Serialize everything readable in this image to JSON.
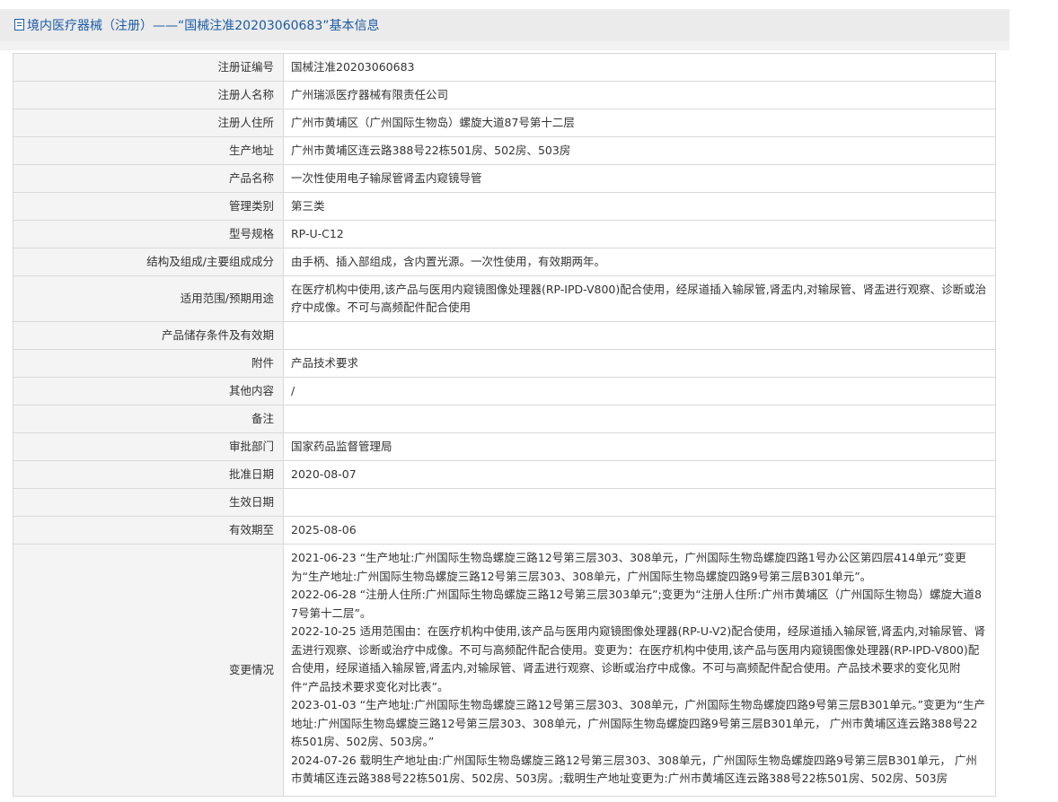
{
  "header": {
    "title": "境内医疗器械（注册）——“国械注准20203060683”基本信息"
  },
  "rows": [
    {
      "label": "注册证编号",
      "value": "国械注准20203060683"
    },
    {
      "label": "注册人名称",
      "value": "广州瑞派医疗器械有限责任公司"
    },
    {
      "label": "注册人住所",
      "value": "广州市黄埔区（广州国际生物岛）螺旋大道87号第十二层"
    },
    {
      "label": "生产地址",
      "value": "广州市黄埔区连云路388号22栋501房、502房、503房"
    },
    {
      "label": "产品名称",
      "value": "一次性使用电子输尿管肾盂内窥镜导管"
    },
    {
      "label": "管理类别",
      "value": "第三类"
    },
    {
      "label": "型号规格",
      "value": "RP-U-C12"
    },
    {
      "label": "结构及组成/主要组成成分",
      "value": "由手柄、插入部组成，含内置光源。一次性使用，有效期两年。"
    },
    {
      "label": "适用范围/预期用途",
      "value": "在医疗机构中使用,该产品与医用内窥镜图像处理器(RP-IPD-V800)配合使用，经尿道插入输尿管,肾盂内,对输尿管、肾盂进行观察、诊断或治疗中成像。不可与高频配件配合使用"
    },
    {
      "label": "产品储存条件及有效期",
      "value": ""
    },
    {
      "label": "附件",
      "value": "产品技术要求"
    },
    {
      "label": "其他内容",
      "value": "/"
    },
    {
      "label": "备注",
      "value": ""
    },
    {
      "label": "审批部门",
      "value": "国家药品监督管理局"
    },
    {
      "label": "批准日期",
      "value": "2020-08-07"
    },
    {
      "label": "生效日期",
      "value": ""
    },
    {
      "label": "有效期至",
      "value": "2025-08-06"
    }
  ],
  "changes": {
    "label": "变更情况",
    "entries": [
      "2021-06-23 “生产地址:广州国际生物岛螺旋三路12号第三层303、308单元，广州国际生物岛螺旋四路1号办公区第四层414单元”变更为“生产地址:广州国际生物岛螺旋三路12号第三层303、308单元，广州国际生物岛螺旋四路9号第三层B301单元”。",
      "2022-06-28 “注册人住所:广州国际生物岛螺旋三路12号第三层303单元”;变更为“注册人住所:广州市黄埔区（广州国际生物岛）螺旋大道87号第十二层”。",
      "2022-10-25 适用范围由：在医疗机构中使用,该产品与医用内窥镜图像处理器(RP-U-V2)配合使用，经尿道插入输尿管,肾盂内,对输尿管、肾盂进行观察、诊断或治疗中成像。不可与高频配件配合使用。变更为：在医疗机构中使用,该产品与医用内窥镜图像处理器(RP-IPD-V800)配合使用，经尿道插入输尿管,肾盂内,对输尿管、肾盂进行观察、诊断或治疗中成像。不可与高频配件配合使用。产品技术要求的变化见附件“产品技术要求变化对比表”。",
      "2023-01-03 “生产地址:广州国际生物岛螺旋三路12号第三层303、308单元，广州国际生物岛螺旋四路9号第三层B301单元。”变更为“生产地址:广州国际生物岛螺旋三路12号第三层303、308单元，广州国际生物岛螺旋四路9号第三层B301单元， 广州市黄埔区连云路388号22栋501房、502房、503房。”",
      "2024-07-26 载明生产地址由:广州国际生物岛螺旋三路12号第三层303、308单元，广州国际生物岛螺旋四路9号第三层B301单元， 广州市黄埔区连云路388号22栋501房、502房、503房。;载明生产地址变更为:广州市黄埔区连云路388号22栋501房、502房、503房"
    ]
  }
}
